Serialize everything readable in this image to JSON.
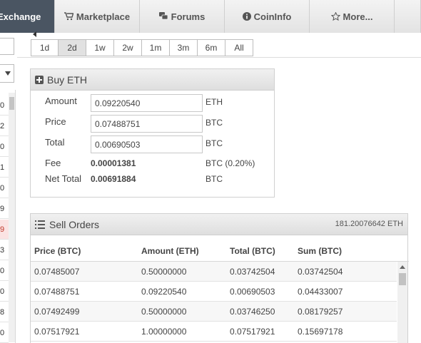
{
  "nav": {
    "tabs": [
      {
        "label": "Exchange",
        "icon": "",
        "active": true
      },
      {
        "label": "Marketplace",
        "icon": "cart-icon",
        "active": false
      },
      {
        "label": "Forums",
        "icon": "chat-bubbles-icon",
        "active": false
      },
      {
        "label": "CoinInfo",
        "icon": "info-circle-icon",
        "active": false
      },
      {
        "label": "More...",
        "icon": "star-icon",
        "active": false
      }
    ]
  },
  "left_column": {
    "row_values": [
      "0",
      "2",
      "0",
      "1",
      "0",
      "9",
      "9",
      "3",
      "0",
      "0",
      "8",
      "0"
    ],
    "highlight_color": "#fbe3e3"
  },
  "timeframes": {
    "options": [
      "1d",
      "2d",
      "1w",
      "2w",
      "1m",
      "3m",
      "6m",
      "All"
    ],
    "selected": "2d"
  },
  "buy": {
    "title": "Buy ETH",
    "amount": {
      "label": "Amount",
      "value": "0.09220540",
      "unit": "ETH"
    },
    "price": {
      "label": "Price",
      "value": "0.07488751",
      "unit": "BTC"
    },
    "total": {
      "label": "Total",
      "value": "0.00690503",
      "unit": "BTC"
    },
    "fee": {
      "label": "Fee",
      "value": "0.00001381",
      "unit": "BTC (0.20%)"
    },
    "net_total": {
      "label": "Net Total",
      "value": "0.00691884",
      "unit": "BTC"
    }
  },
  "sell_orders": {
    "title": "Sell Orders",
    "total": "181.20076642 ETH",
    "columns": [
      "Price (BTC)",
      "Amount (ETH)",
      "Total (BTC)",
      "Sum (BTC)"
    ],
    "rows": [
      [
        "0.07485007",
        "0.50000000",
        "0.03742504",
        "0.03742504"
      ],
      [
        "0.07488751",
        "0.09220540",
        "0.00690503",
        "0.04433007"
      ],
      [
        "0.07492499",
        "0.50000000",
        "0.03746250",
        "0.08179257"
      ],
      [
        "0.07517921",
        "1.00000000",
        "0.07517921",
        "0.15697178"
      ]
    ]
  },
  "colors": {
    "nav_active": "#4a5562",
    "panel_head": "#e6e6e6",
    "text": "#444444"
  }
}
